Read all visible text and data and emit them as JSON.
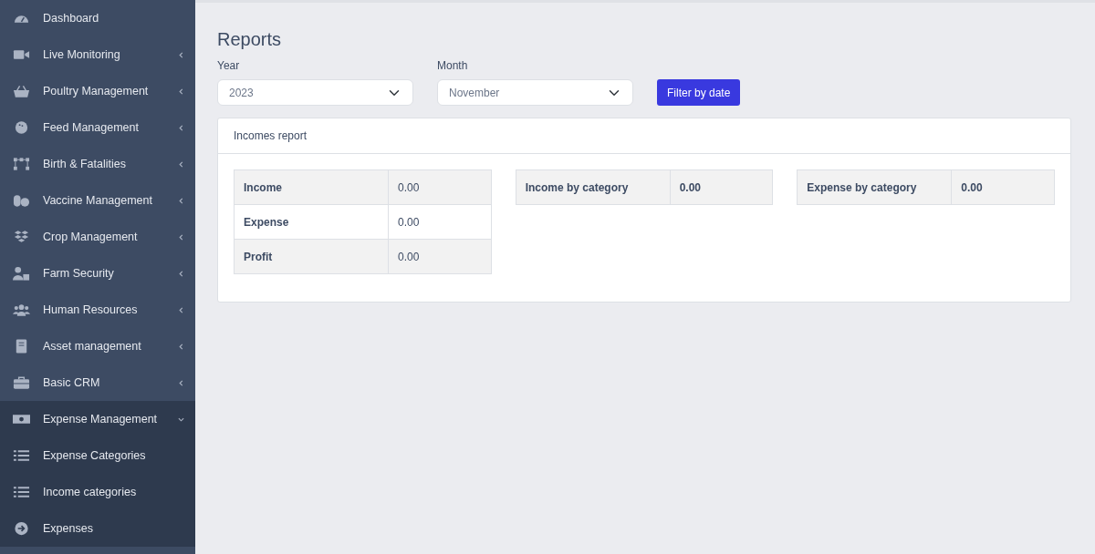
{
  "sidebar": {
    "items": [
      {
        "label": "Dashboard"
      },
      {
        "label": "Live Monitoring",
        "expanded": false
      },
      {
        "label": "Poultry Management",
        "expanded": false
      },
      {
        "label": "Feed Management",
        "expanded": false
      },
      {
        "label": "Birth & Fatalities",
        "expanded": false
      },
      {
        "label": "Vaccine Management",
        "expanded": false
      },
      {
        "label": "Crop Management",
        "expanded": false
      },
      {
        "label": "Farm Security",
        "expanded": false
      },
      {
        "label": "Human Resources",
        "expanded": false
      },
      {
        "label": "Asset management",
        "expanded": false
      },
      {
        "label": "Basic CRM",
        "expanded": false
      },
      {
        "label": "Expense Management",
        "expanded": true,
        "children": [
          {
            "label": "Expense Categories"
          },
          {
            "label": "Income categories"
          },
          {
            "label": "Expenses"
          }
        ]
      }
    ]
  },
  "page": {
    "title": "Reports"
  },
  "filters": {
    "year": {
      "label": "Year",
      "value": "2023"
    },
    "month": {
      "label": "Month",
      "value": "November"
    },
    "button": "Filter by date"
  },
  "card": {
    "title": "Incomes report",
    "tables": [
      {
        "rows": [
          {
            "label": "Income",
            "value": "0.00"
          },
          {
            "label": "Expense",
            "value": "0.00"
          },
          {
            "label": "Profit",
            "value": "0.00"
          }
        ]
      },
      {
        "rows": [
          {
            "label": "Income by category",
            "value": "0.00"
          }
        ]
      },
      {
        "rows": [
          {
            "label": "Expense by category",
            "value": "0.00"
          }
        ]
      }
    ]
  }
}
